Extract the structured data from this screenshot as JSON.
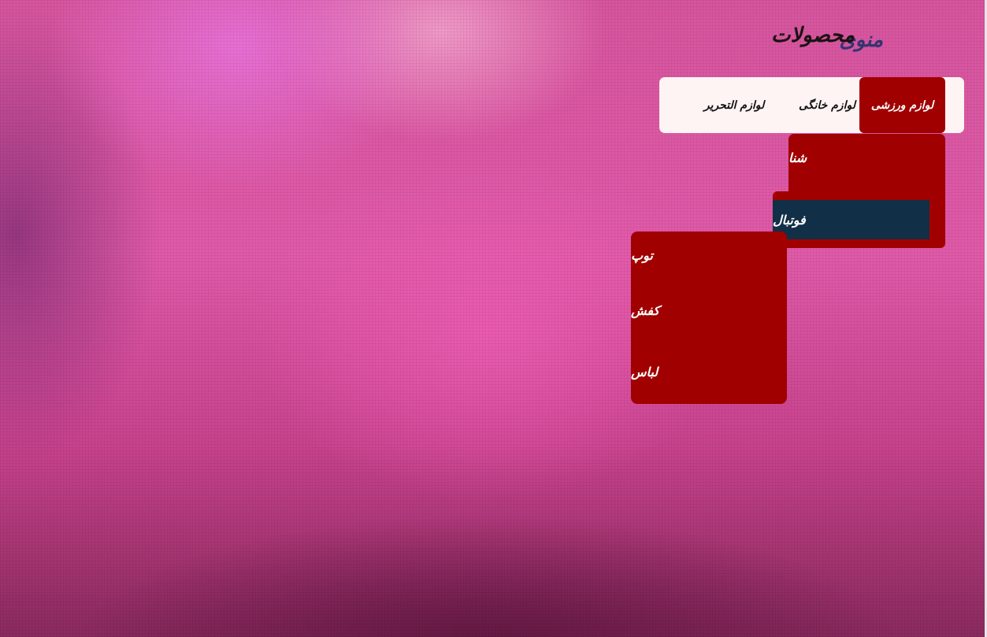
{
  "logo": {
    "text_primary": "منوی",
    "text_secondary": "محصولات",
    "ghost_text": "منوی محصولات"
  },
  "menu": {
    "items": [
      {
        "label": "لوازم ورزشی"
      },
      {
        "label": "لوازم خانگی"
      },
      {
        "label": "لوازم التحریر"
      }
    ]
  },
  "submenu_sports": {
    "items": [
      {
        "label": "شنا"
      },
      {
        "label": "فوتبال"
      }
    ]
  },
  "submenu_football": {
    "items": [
      {
        "label": "توپ"
      },
      {
        "label": "کفش"
      },
      {
        "label": "لباس"
      }
    ]
  },
  "colors": {
    "menu_active": "#a10000",
    "submenu_bg": "#a10000",
    "highlight": "#112f46",
    "menubar_bg": "#fff4f4"
  }
}
